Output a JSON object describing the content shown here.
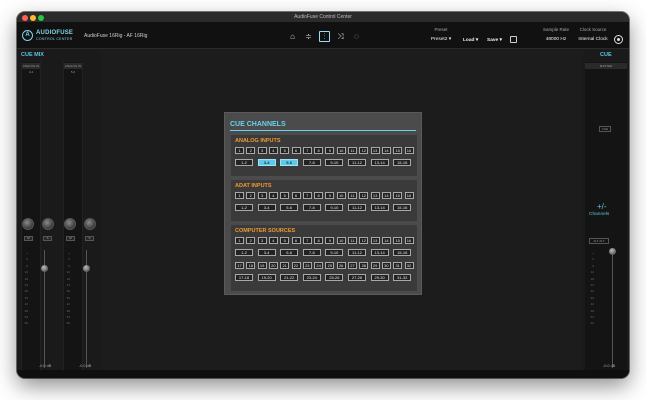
{
  "window": {
    "title": "AudioFuse Control Center"
  },
  "toolbar": {
    "logo_initial": "A",
    "logo_text": "AUDIOFUSE",
    "logo_sub": "CONTROL CENTER",
    "device_name": "AudioFuse 16Rig - AF 16Rig",
    "icons": [
      "home-icon",
      "mixer-icon",
      "cue-icon",
      "routing-icon",
      "link-icon"
    ],
    "preset_label": "Preset",
    "preset_value": "Preset2 ▾",
    "load_label": "Load ▾",
    "save_label": "Save ▾",
    "sample_rate_label": "Sample Rate",
    "sample_rate_value": "48000 Hz",
    "clock_source_label": "Clock Source",
    "clock_source_value": "Internal Clock"
  },
  "left_panel": {
    "title": "CUE MIX",
    "strips": [
      {
        "label": "ANALOG IN 3-4"
      },
      {
        "label": "ANALOG IN 5-6"
      }
    ],
    "db_readout": "-0.0 dB"
  },
  "right_panel": {
    "title": "CUE",
    "strip_label": "MASTER",
    "cue_button": "CUE",
    "channels_symbol": "+/-",
    "channels_label": "Channels",
    "toggle_label": "ALT  ALT",
    "db_readout": "-0.0 dB"
  },
  "dialog": {
    "title": "CUE CHANNELS",
    "sections": [
      {
        "title": "ANALOG INPUTS",
        "singles": [
          "1",
          "2",
          "3",
          "4",
          "5",
          "6",
          "7",
          "8",
          "9",
          "10",
          "11",
          "12",
          "13",
          "14",
          "15",
          "16"
        ],
        "pairs": [
          "1-2",
          "3-4",
          "5-6",
          "7-8",
          "9-10",
          "11-12",
          "13-14",
          "15-16"
        ],
        "selected_pairs": [
          "3-4",
          "5-6"
        ]
      },
      {
        "title": "ADAT INPUTS",
        "singles": [
          "1",
          "2",
          "3",
          "4",
          "5",
          "6",
          "7",
          "8",
          "9",
          "10",
          "11",
          "12",
          "13",
          "14",
          "15",
          "16"
        ],
        "pairs": [
          "1-2",
          "3-4",
          "5-6",
          "7-8",
          "9-10",
          "11-12",
          "13-14",
          "15-16"
        ],
        "selected_pairs": []
      },
      {
        "title": "COMPUTER SOURCES",
        "singles": [
          "1",
          "2",
          "3",
          "4",
          "5",
          "6",
          "7",
          "8",
          "9",
          "10",
          "11",
          "12",
          "13",
          "14",
          "15",
          "16"
        ],
        "pairs": [
          "1-2",
          "3-4",
          "5-6",
          "7-8",
          "9-10",
          "11-12",
          "13-14",
          "15-16"
        ],
        "singles2": [
          "17",
          "18",
          "19",
          "20",
          "21",
          "22",
          "23",
          "24",
          "25",
          "26",
          "27",
          "28",
          "29",
          "30",
          "31",
          "32"
        ],
        "pairs2": [
          "17-18",
          "19-20",
          "21-22",
          "23-24",
          "25-26",
          "27-28",
          "29-30",
          "31-32"
        ],
        "selected_pairs": []
      }
    ]
  },
  "colors": {
    "accent": "#5fc9ea",
    "section_title": "#f29a2e",
    "background": "#1c1c1c"
  }
}
